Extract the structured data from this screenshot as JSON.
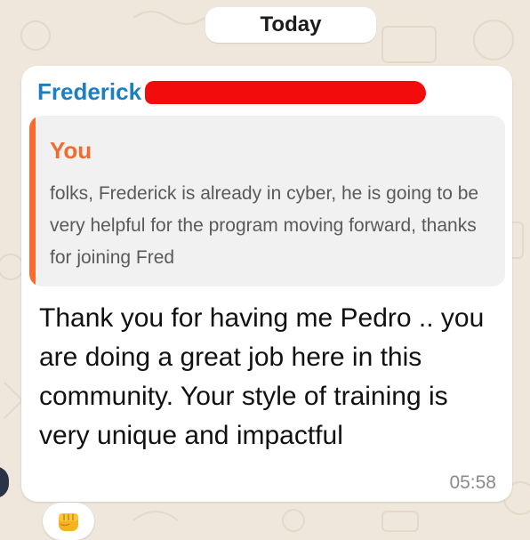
{
  "chat": {
    "date_label": "Today"
  },
  "message": {
    "sender_name": "Frederick",
    "sender_color": "#1c7fbf",
    "quoted": {
      "author": "You",
      "author_color": "#f26a2e",
      "text": "folks, Frederick is already in cyber, he is going to be very helpful for the program moving forward, thanks for joining Fred"
    },
    "body": "Thank you for having me Pedro .. you are doing a great job here in this community. Your style of training is very unique and impactful",
    "time": "05:58",
    "reaction": "fist-bump-icon"
  },
  "colors": {
    "redaction": "#f20c0c",
    "wallpaper": "#efe7dc",
    "quote_bar": "#ff6a2c"
  }
}
